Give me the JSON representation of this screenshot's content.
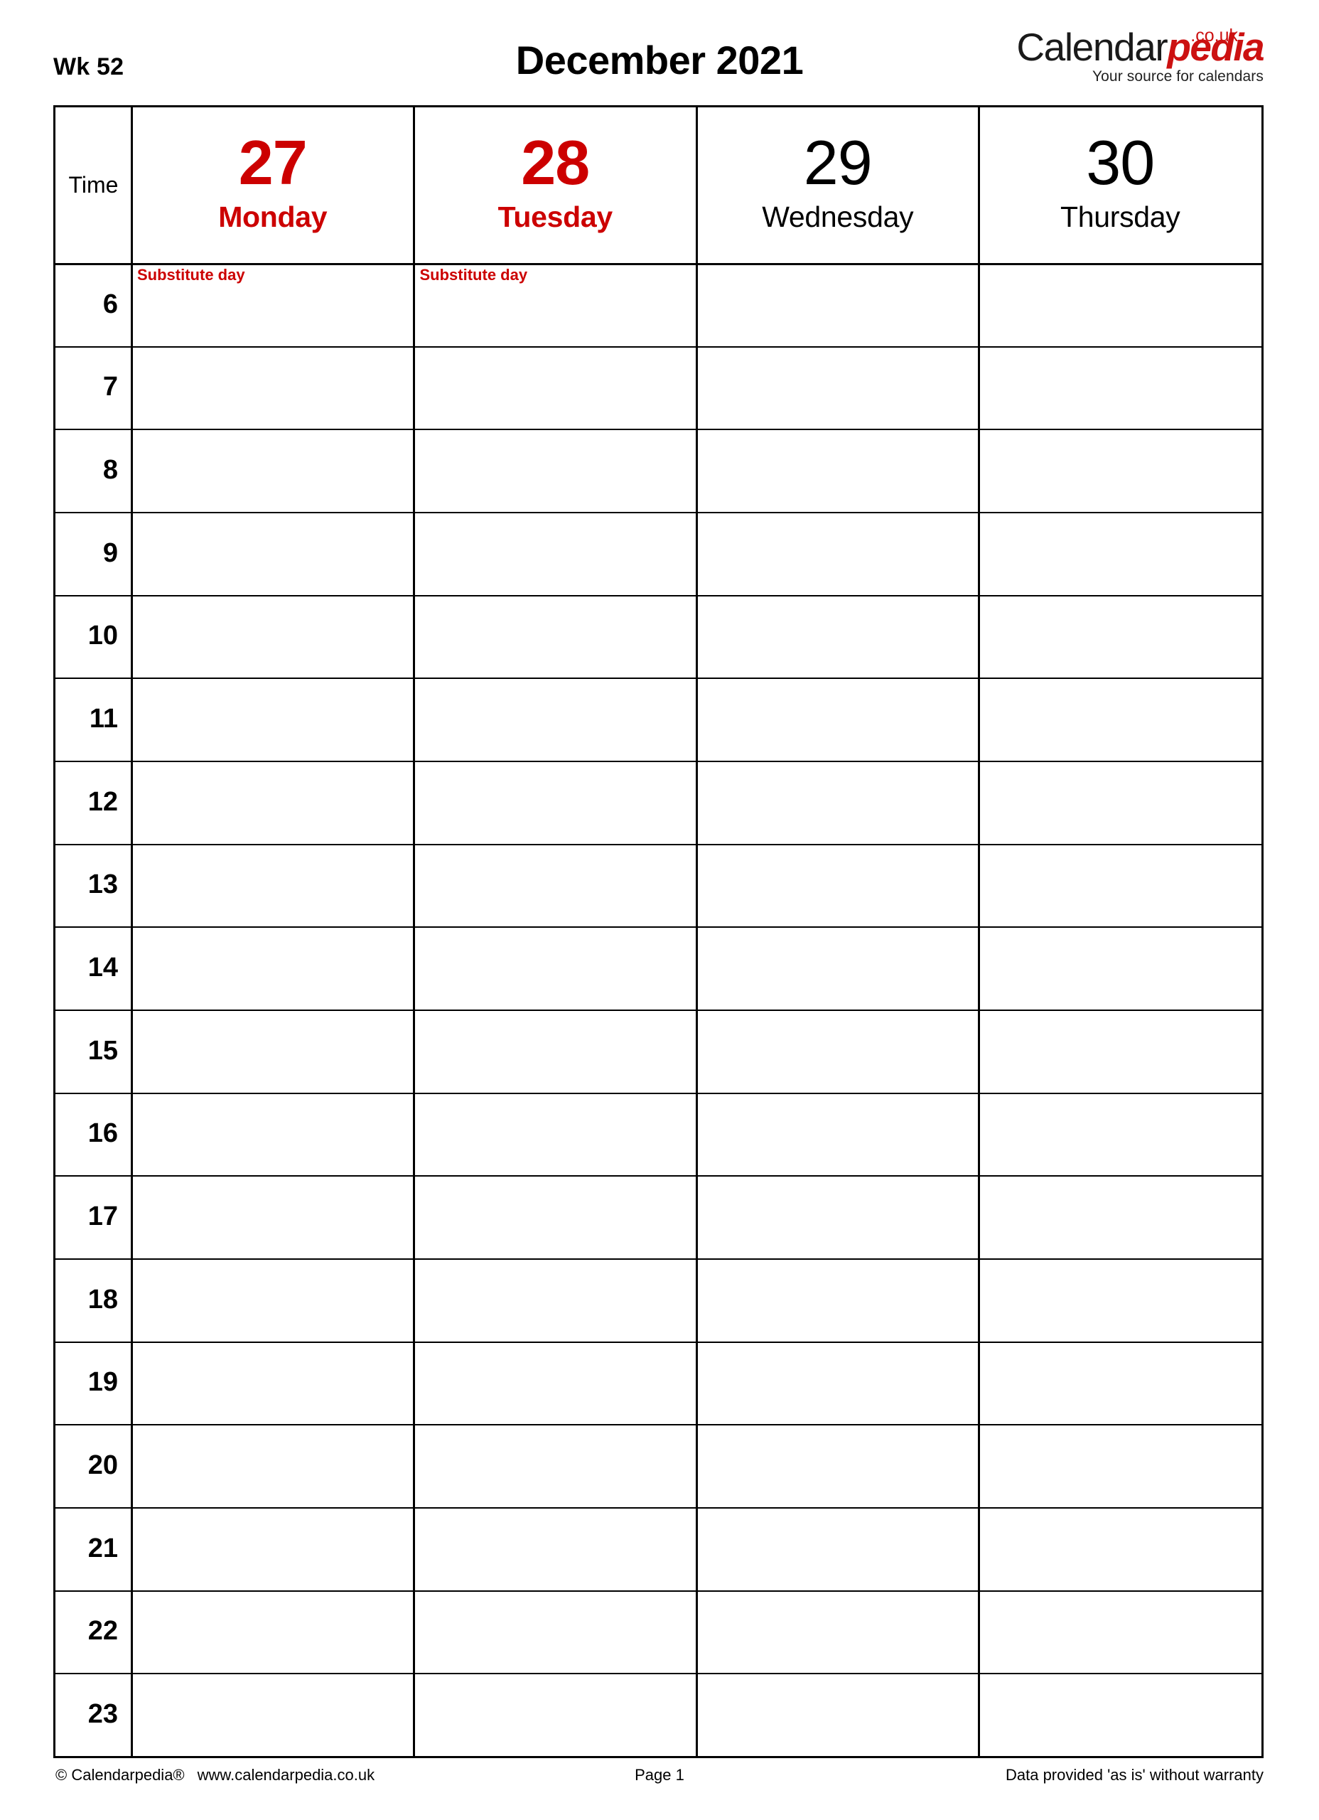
{
  "header": {
    "week_label": "Wk 52",
    "month_title": "December 2021"
  },
  "logo": {
    "brand_first": "Calendar",
    "brand_second": "pedia",
    "tld": ".co.uk",
    "tagline": "Your source for calendars",
    "accent_color": "#cc1111"
  },
  "table": {
    "time_column_header": "Time",
    "days": [
      {
        "number": "27",
        "name": "Monday",
        "highlight": true,
        "note": "Substitute day"
      },
      {
        "number": "28",
        "name": "Tuesday",
        "highlight": true,
        "note": "Substitute day"
      },
      {
        "number": "29",
        "name": "Wednesday",
        "highlight": false,
        "note": ""
      },
      {
        "number": "30",
        "name": "Thursday",
        "highlight": false,
        "note": ""
      }
    ],
    "hours": [
      "6",
      "7",
      "8",
      "9",
      "10",
      "11",
      "12",
      "13",
      "14",
      "15",
      "16",
      "17",
      "18",
      "19",
      "20",
      "21",
      "22",
      "23"
    ],
    "highlight_color": "#cc0000",
    "line_color": "#000000"
  },
  "footer": {
    "copyright": "© Calendarpedia®",
    "website": "www.calendarpedia.co.uk",
    "page": "Page 1",
    "disclaimer": "Data provided 'as is' without warranty"
  }
}
